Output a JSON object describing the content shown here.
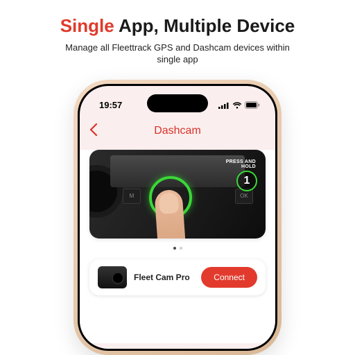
{
  "headline": {
    "accent": "Single",
    "rest": " App, Multiple Device"
  },
  "subhead": "Manage all Fleettrack GPS and Dashcam devices within single app",
  "status": {
    "time": "19:57"
  },
  "nav": {
    "title": "Dashcam"
  },
  "hero": {
    "press_hold_line1": "PRESS AND",
    "press_hold_line2": "HOLD",
    "step": "1",
    "btn_m": "M",
    "btn_ok": "OK"
  },
  "carousel": {
    "active_index": 0,
    "count": 2
  },
  "device": {
    "name": "Fleet Cam Pro",
    "connect_label": "Connect"
  }
}
